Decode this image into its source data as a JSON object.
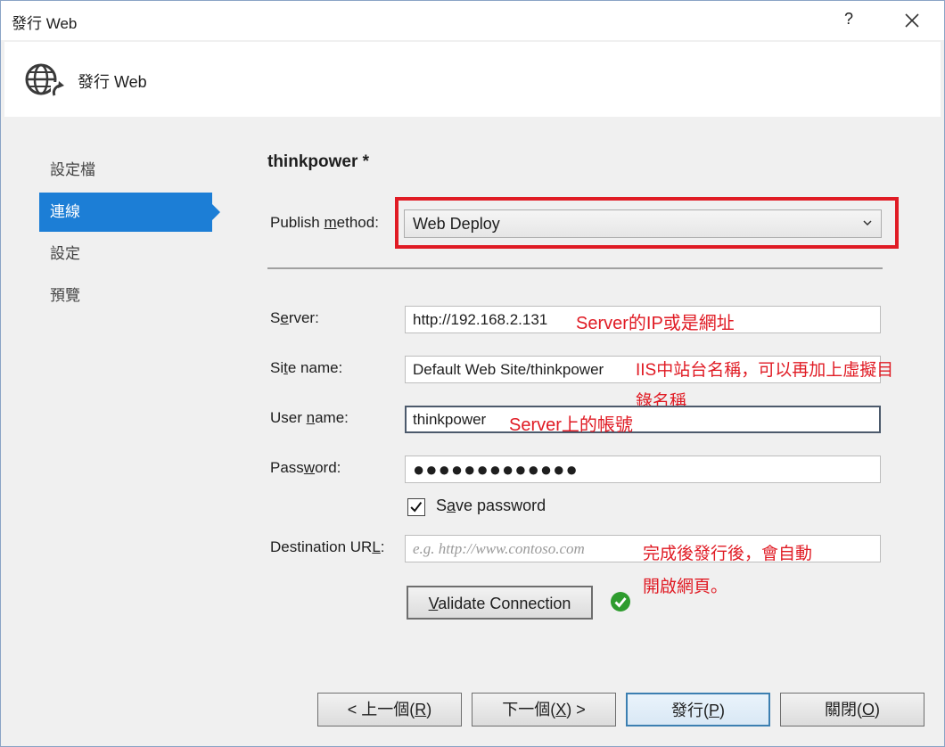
{
  "window": {
    "title": "發行 Web",
    "help": "?",
    "close_icon": "close-icon"
  },
  "header": {
    "title": "發行 Web",
    "icon": "globe-refresh-icon"
  },
  "nav": {
    "items": [
      {
        "label": "設定檔"
      },
      {
        "label": "連線",
        "active": true
      },
      {
        "label": "設定"
      },
      {
        "label": "預覽"
      }
    ]
  },
  "profile": {
    "name": "thinkpower *"
  },
  "publish_method": {
    "label_before": "Publish ",
    "label_key": "m",
    "label_after": "ethod:",
    "value": "Web Deploy"
  },
  "server": {
    "label_before": "S",
    "label_key": "e",
    "label_after": "rver:",
    "value": "http://192.168.2.131"
  },
  "site_name": {
    "label_before": "Si",
    "label_key": "t",
    "label_after": "e name:",
    "value": "Default Web Site/thinkpower"
  },
  "user_name": {
    "label_before": "User ",
    "label_key": "n",
    "label_after": "ame:",
    "value": "thinkpower"
  },
  "password": {
    "label_before": "Pass",
    "label_key": "w",
    "label_after": "ord:",
    "value": "●●●●●●●●●●●●●"
  },
  "save_password": {
    "checked": true,
    "label_before": "S",
    "label_key": "a",
    "label_after": "ve password"
  },
  "destination_url": {
    "label_before": "Destination UR",
    "label_key": "L",
    "label_after": ":",
    "placeholder": "e.g. http://www.contoso.com"
  },
  "validate": {
    "label_before": "",
    "label_key": "V",
    "label_after": "alidate Connection",
    "status_icon": "check-circle-icon"
  },
  "annotations": {
    "server": "Server的IP或是網址",
    "site_line1": "IIS中站台名稱，可以再加上虛擬目",
    "site_line2": "錄名稱",
    "user": "Server上的帳號",
    "url_line1": "完成後發行後，會自動",
    "url_line2": "開啟網頁。",
    "highlight_color": "#e01b24"
  },
  "footer": {
    "prev": {
      "before": "< 上一個(",
      "key": "R",
      "after": ")"
    },
    "next": {
      "before": "下一個(",
      "key": "X",
      "after": ") >"
    },
    "publish": {
      "before": "發行(",
      "key": "P",
      "after": ")"
    },
    "close": {
      "before": "關閉(",
      "key": "O",
      "after": ")"
    }
  },
  "colors": {
    "accent": "#1c7ed6",
    "annotation": "#e01b24",
    "success": "#2e9c2e"
  }
}
